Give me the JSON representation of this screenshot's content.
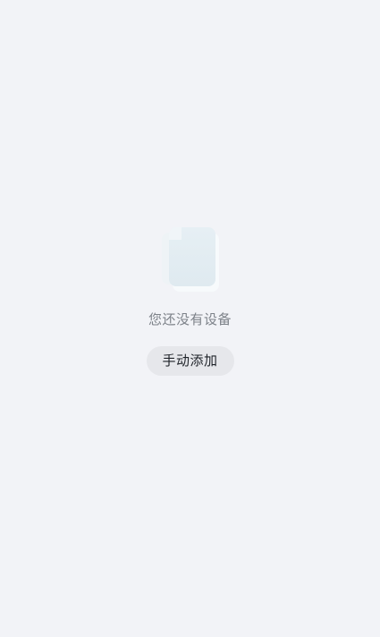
{
  "empty_state": {
    "illustration_icon": "empty-document-icon",
    "message": "您还没有设备",
    "add_button_label": "手动添加"
  }
}
